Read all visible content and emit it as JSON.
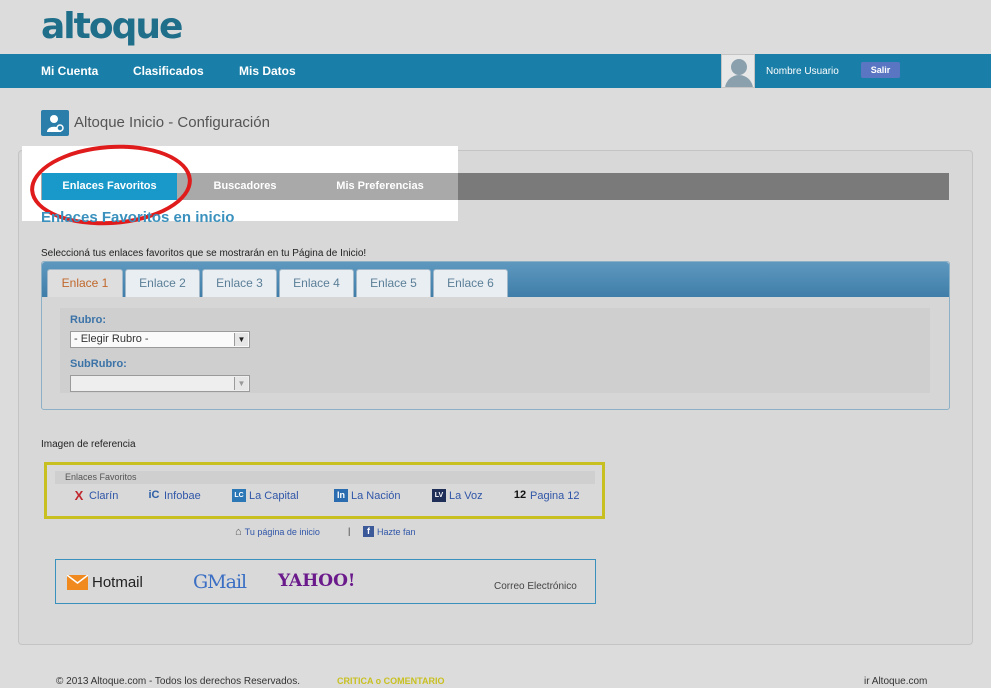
{
  "header": {
    "logo": "altoque",
    "nav": [
      "Mi Cuenta",
      "Clasificados",
      "Mis Datos"
    ],
    "user_name": "Nombre Usuario",
    "logout_label": "Salir"
  },
  "page_title": "Altoque Inicio - Configuración",
  "main_tabs": [
    "Enlaces Favoritos",
    "Buscadores",
    "Mis Preferencias"
  ],
  "section_title": "Enlaces Favoritos en inicio",
  "instructions": "Seleccioná tus enlaces favoritos que se mostrarán en tu Página de Inicio!",
  "enlace_tabs": [
    "Enlace 1",
    "Enlace 2",
    "Enlace 3",
    "Enlace 4",
    "Enlace 5",
    "Enlace 6"
  ],
  "form": {
    "rubro_label": "Rubro:",
    "rubro_value": "- Elegir Rubro -",
    "subrubro_label": "SubRubro:",
    "subrubro_value": ""
  },
  "reference": {
    "label": "Imagen de referencia",
    "header": "Enlaces Favoritos",
    "links": [
      {
        "label": "Clarín",
        "icon": "X"
      },
      {
        "label": "Infobae",
        "icon": "iC"
      },
      {
        "label": "La Capital",
        "icon": "LC"
      },
      {
        "label": "La Nación",
        "icon": "ln"
      },
      {
        "label": "La Voz",
        "icon": "LV"
      },
      {
        "label": "Pagina 12",
        "icon": "12"
      }
    ],
    "home_link": "Tu página de inicio",
    "separator": "|",
    "fan_link": "Hazte fan"
  },
  "email": {
    "hotmail": "Hotmail",
    "gmail": "GMail",
    "yahoo": "YAHOO!",
    "caption": "Correo Electrónico"
  },
  "footer": {
    "copyright": "© 2013  Altoque.com - Todos los derechos Reservados.",
    "critica": "CRITICA o COMENTARIO",
    "ir": "ir Altoque.com"
  },
  "colors": {
    "nav_bar": "#1a7fa8",
    "active_tab": "#1899c9",
    "highlight_circle": "#e01b1b",
    "reference_border": "#c8c020"
  }
}
